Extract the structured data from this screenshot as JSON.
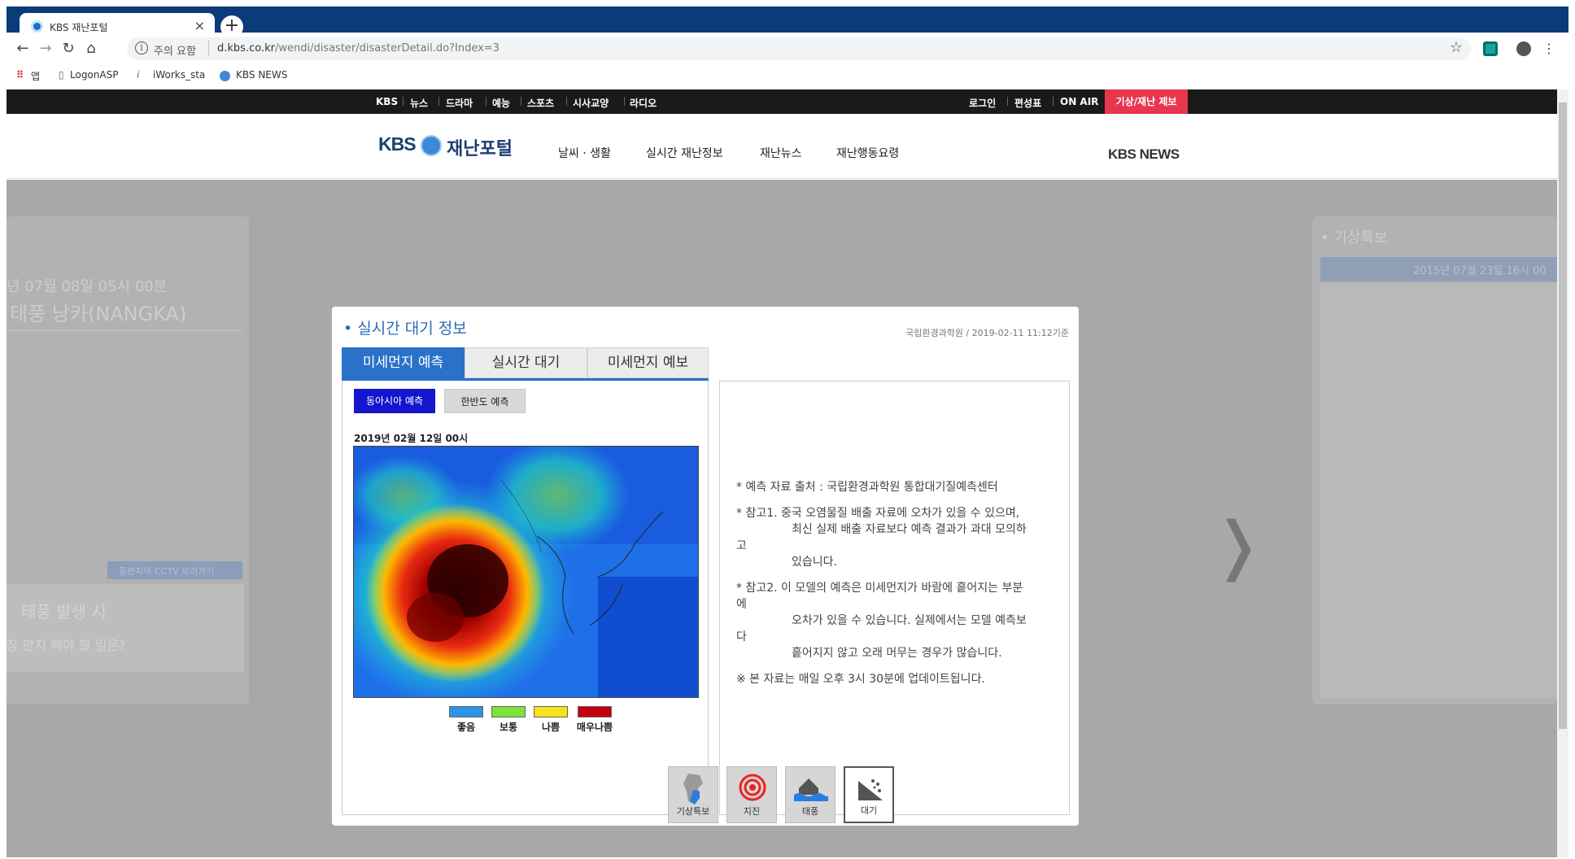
{
  "browser": {
    "tab_title": "KBS 재난포털",
    "tab_close": "×",
    "new_tab": "+",
    "url_warning": "주의 요함",
    "url_domain": "d.kbs.co.kr",
    "url_path": "/wendi/disaster/disasterDetail.do?Index=3",
    "bookmarks": [
      "앱",
      "LogonASP",
      "iWorks_sta",
      "KBS NEWS"
    ]
  },
  "gnb": {
    "left_items": [
      "KBS",
      "뉴스",
      "드라마",
      "예능",
      "스포츠",
      "시사교양",
      "라디오"
    ],
    "right_items": [
      "로그인",
      "편성표",
      "ON AIR"
    ],
    "report_label": "기상/재난 제보"
  },
  "header": {
    "logo_kbs": "KBS",
    "logo_name": "재난포털",
    "nav": [
      "날씨 · 생활",
      "실시간 재난정보",
      "재난뉴스",
      "재난행동요령"
    ],
    "kbs_news": "KBS NEWS"
  },
  "background": {
    "left_date": "년 07월 08일 05시 00분",
    "left_title": "태풍 낭카(NANGKA)",
    "cctv_label": "중변지역 CCTV 보러가기",
    "typhoon_title": "태풍 발생 시",
    "typhoon_sub": "창 만지 해야 할 일은?",
    "right_title": "• 기상특보",
    "right_date": "2015년 07월 23일 16시 00"
  },
  "modal": {
    "title": "• 실시간 대기 정보",
    "source": "국립환경과학원 / 2019-02-11 11:12기준",
    "tabs": [
      "미세먼지 예측",
      "실시간 대기",
      "미세먼지 예보"
    ],
    "sub_buttons": [
      "동아시아 예측",
      "한반도 예측"
    ],
    "map_date": "2019년 02월 12일 00시",
    "legend": [
      {
        "label": "좋음",
        "color": "#2c95e8"
      },
      {
        "label": "보통",
        "color": "#7de23a"
      },
      {
        "label": "나쁨",
        "color": "#f6e21a"
      },
      {
        "label": "매우나쁨",
        "color": "#c4000c"
      }
    ],
    "notes": [
      "* 예측 자료 출처 : 국립환경과학원 통합대기질예측센터",
      "* 참고1. 중국 오염물질 배출 자료에 오차가 있을 수 있으며,",
      "최신 실제 배출 자료보다 예측 결과가 과대 모의하",
      "고",
      "있습니다.",
      "* 참고2. 이 모델의 예측은 미세먼지가 바람에 흩어지는 부분",
      "에",
      "오차가 있을 수 있습니다. 실제에서는 모델 예측보",
      "다",
      "흩어지지 않고 오래 머무는 경우가 많습니다.",
      "※ 본 자료는 매일 오후 3시 30분에 업데이트됩니다."
    ]
  },
  "nav_arrows": {
    "prev": "❬",
    "next": "❭"
  },
  "dock": [
    "기상특보",
    "지진",
    "태풍",
    "대기"
  ]
}
